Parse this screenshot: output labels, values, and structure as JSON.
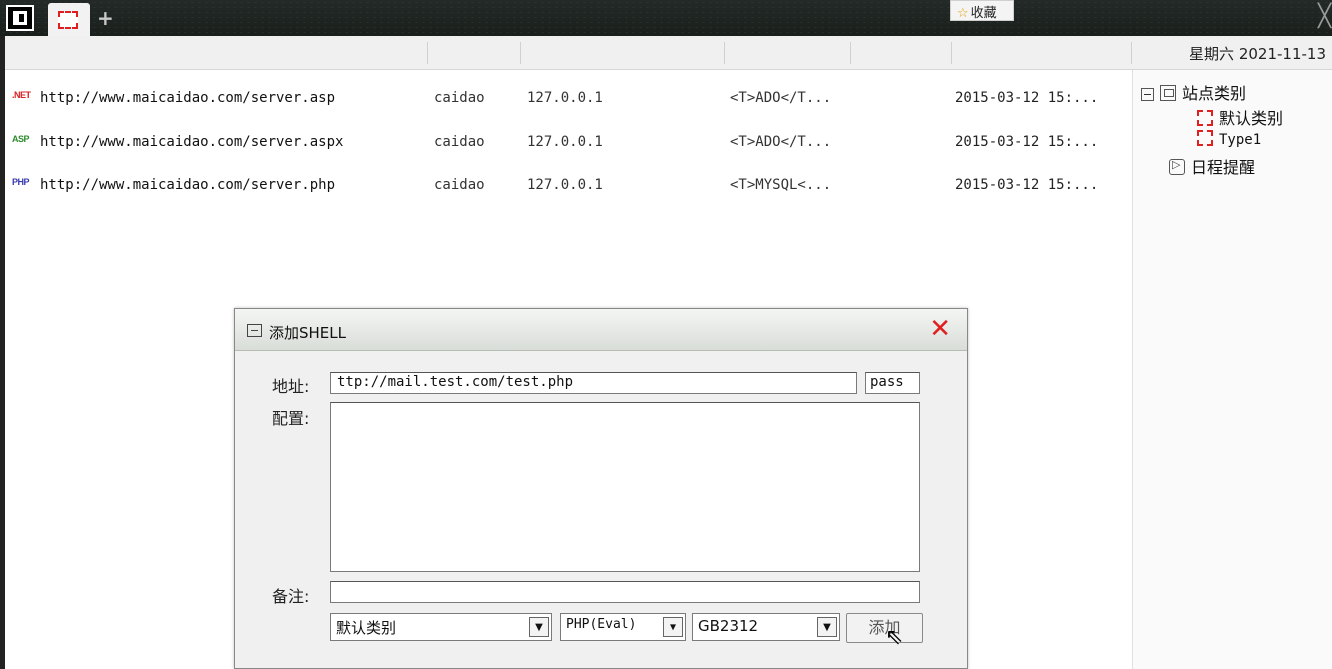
{
  "topbar": {
    "favorites_label": "收藏",
    "star_icon": "☆",
    "plus_icon": "+",
    "close_icon": "╳"
  },
  "header": {
    "date": "星期六 2021-11-13"
  },
  "rows": [
    {
      "badge": ".NET",
      "badge_color": "#d62020",
      "url": "http://www.maicaidao.com/server.asp",
      "password": "caidao",
      "ip": "127.0.0.1",
      "config": "<T>ADO</T...",
      "time": "2015-03-12 15:..."
    },
    {
      "badge": "ASP",
      "badge_color": "#2e8b2e",
      "url": "http://www.maicaidao.com/server.aspx",
      "password": "caidao",
      "ip": "127.0.0.1",
      "config": "<T>ADO</T...",
      "time": "2015-03-12 15:..."
    },
    {
      "badge": "PHP",
      "badge_color": "#3a3ab0",
      "url": "http://www.maicaidao.com/server.php",
      "password": "caidao",
      "ip": "127.0.0.1",
      "config": "<T>MYSQL<...",
      "time": "2015-03-12 15:..."
    }
  ],
  "tree": {
    "root": "站点类别",
    "children": [
      "默认类别",
      "Type1"
    ],
    "schedule": "日程提醒"
  },
  "dialog": {
    "title": "添加SHELL",
    "close_icon": "✕",
    "address_label": "地址:",
    "address_value": "ttp://mail.test.com/test.php",
    "password_value": "pass",
    "config_label": "配置:",
    "config_value": "",
    "note_label": "备注:",
    "note_value": "",
    "category_selected": "默认类别",
    "type_selected": "PHP(Eval)",
    "encoding_selected": "GB2312",
    "add_button": "添加"
  }
}
